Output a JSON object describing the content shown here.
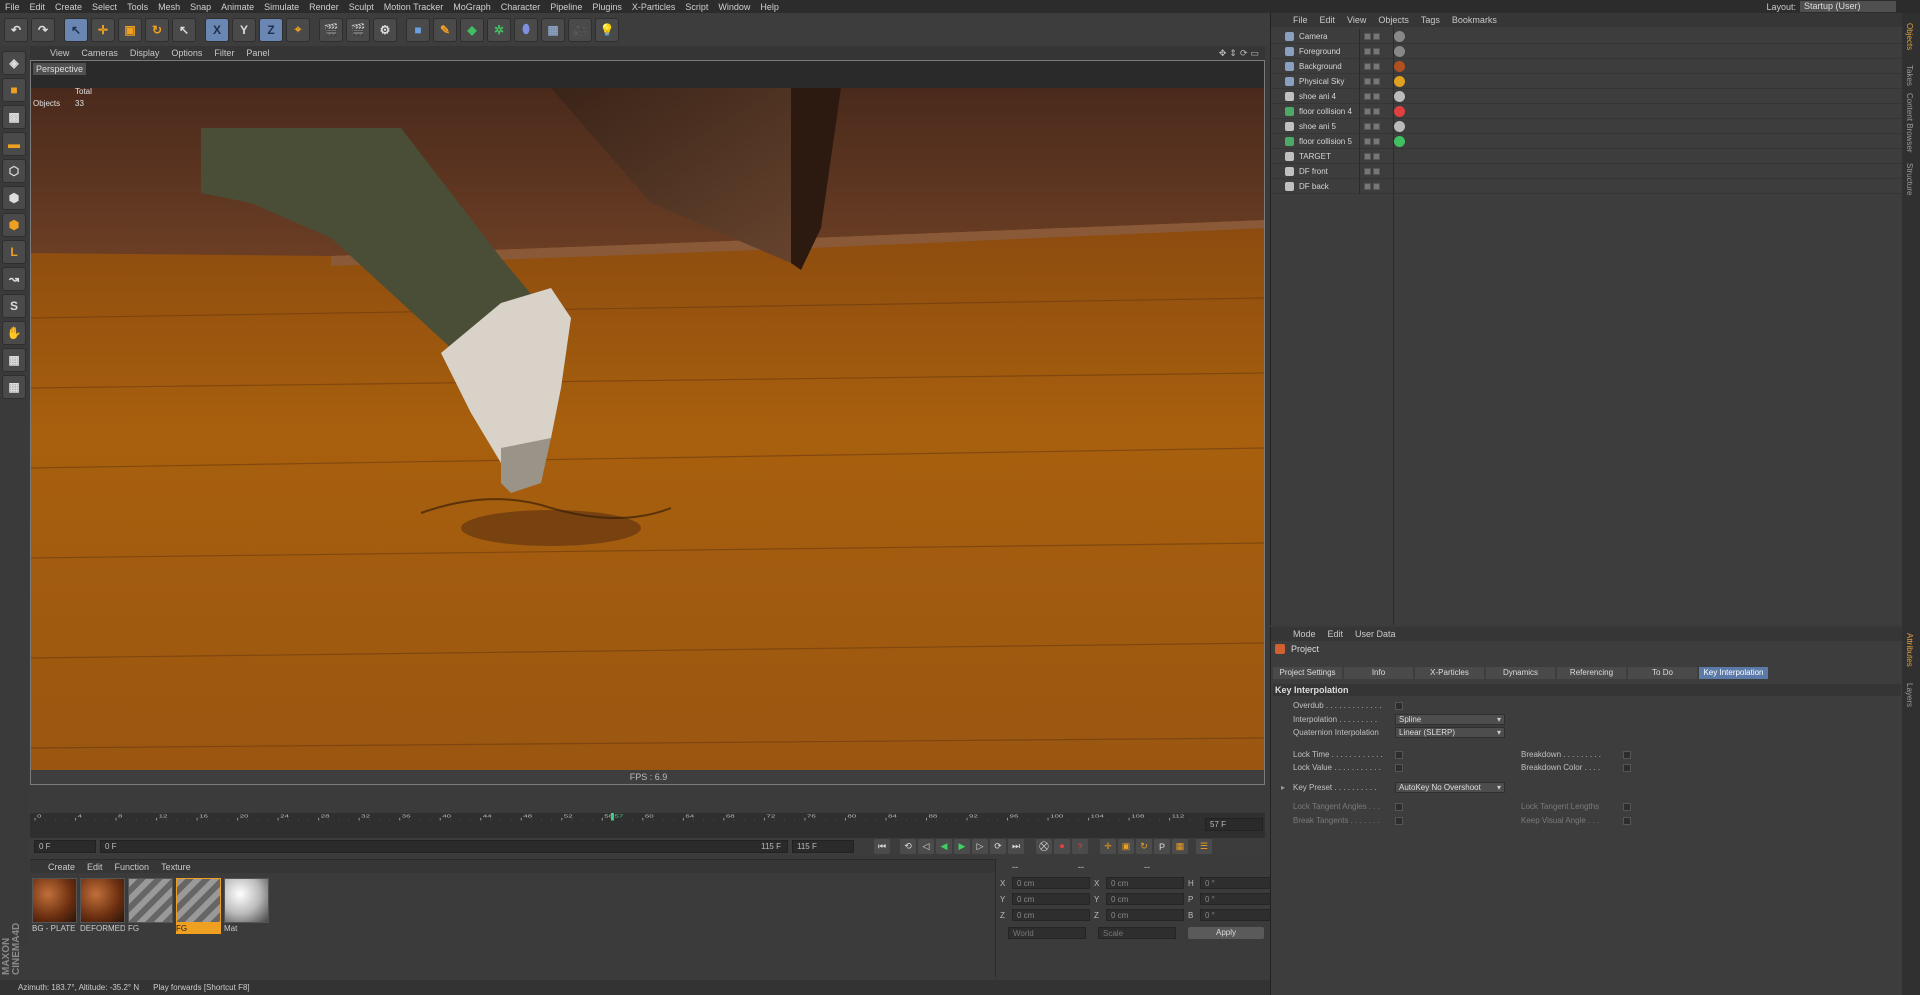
{
  "menubar": {
    "items": [
      "File",
      "Edit",
      "Create",
      "Select",
      "Tools",
      "Mesh",
      "Snap",
      "Animate",
      "Simulate",
      "Render",
      "Sculpt",
      "Motion Tracker",
      "MoGraph",
      "Character",
      "Pipeline",
      "Plugins",
      "X-Particles",
      "Script",
      "Window",
      "Help"
    ],
    "layout_label": "Layout:",
    "layout_value": "Startup (User)"
  },
  "toolbar": {
    "icons": [
      "undo-icon",
      "redo-icon",
      "live-select-icon",
      "move-icon",
      "scale-icon",
      "rotate-icon",
      "recent-tool-icon",
      "x-axis-icon",
      "y-axis-icon",
      "z-axis-icon",
      "coordinate-system-icon",
      "render-view-icon",
      "render-picture-viewer-icon",
      "edit-render-settings-icon",
      "cube-icon",
      "pen-icon",
      "subdivision-icon",
      "cloner-icon",
      "deformer-icon",
      "floor-icon",
      "camera-icon",
      "light-icon"
    ],
    "axis_labels": [
      "X",
      "Y",
      "Z"
    ]
  },
  "viewport": {
    "menu": [
      "View",
      "Cameras",
      "Display",
      "Options",
      "Filter",
      "Panel"
    ],
    "label": "Perspective",
    "stats_total": "Total",
    "stats_objects_label": "Objects",
    "stats_objects_value": "33",
    "fps": "FPS : 6.9"
  },
  "timeline": {
    "ticks": [
      "0",
      "4",
      "8",
      "12",
      "16",
      "20",
      "24",
      "28",
      "32",
      "36",
      "40",
      "44",
      "48",
      "52",
      "56",
      "57",
      "60",
      "64",
      "68",
      "72",
      "76",
      "80",
      "84",
      "88",
      "92",
      "96",
      "100",
      "104",
      "108",
      "112"
    ],
    "current_frame": "57",
    "current_frame_field": "57 F",
    "start_field": "0 F",
    "range_start": "0 F",
    "range_end": "115 F",
    "end_field": "115 F"
  },
  "materials": {
    "menu": [
      "Create",
      "Edit",
      "Function",
      "Texture"
    ],
    "items": [
      {
        "label": "BG - PLATE",
        "color": "#7a3a14"
      },
      {
        "label": "DEFORMED",
        "color": "#7a3a14"
      },
      {
        "label": "FG",
        "color": "#888888"
      },
      {
        "label": "FG",
        "color": "#8a6a4a"
      },
      {
        "label": "Mat",
        "color": "#cccccc"
      }
    ]
  },
  "coords": {
    "headers": [
      "--",
      "--",
      "--"
    ],
    "rows": [
      [
        "X",
        "0 cm",
        "X",
        "0 cm",
        "H",
        "0 °"
      ],
      [
        "Y",
        "0 cm",
        "Y",
        "0 cm",
        "P",
        "0 °"
      ],
      [
        "Z",
        "0 cm",
        "Z",
        "0 cm",
        "B",
        "0 °"
      ]
    ],
    "mode1": "World",
    "mode2": "Scale",
    "apply": "Apply"
  },
  "status": {
    "left": "Azimuth: 183.7°, Altitude: -35.2°  N",
    "right": "Play forwards [Shortcut F8]"
  },
  "objects": {
    "menu": [
      "File",
      "Edit",
      "View",
      "Objects",
      "Tags",
      "Bookmarks"
    ],
    "rows": [
      {
        "name": "Camera",
        "icon_color": "#8aa0c0"
      },
      {
        "name": "Foreground",
        "icon_color": "#8aa0c0"
      },
      {
        "name": "Background",
        "icon_color": "#8aa0c0"
      },
      {
        "name": "Physical Sky",
        "icon_color": "#8aa0c0"
      },
      {
        "name": "shoe ani 4",
        "icon_color": "#c0c0c0"
      },
      {
        "name": "floor collision 4",
        "icon_color": "#4caa66"
      },
      {
        "name": "shoe ani 5",
        "icon_color": "#c0c0c0"
      },
      {
        "name": "floor collision 5",
        "icon_color": "#4caa66"
      },
      {
        "name": "TARGET",
        "icon_color": "#c0c0c0"
      },
      {
        "name": "DF front",
        "icon_color": "#c0c0c0"
      },
      {
        "name": "DF back",
        "icon_color": "#c0c0c0"
      }
    ]
  },
  "attributes": {
    "menu": [
      "Mode",
      "Edit",
      "User Data"
    ],
    "title": "Project",
    "tabs": [
      "Project Settings",
      "Info",
      "X-Particles",
      "Dynamics",
      "Referencing",
      "To Do",
      "Key Interpolation"
    ],
    "section": "Key Interpolation",
    "overdub": "Overdub . . . . . . . . . . . . .",
    "interpolation": "Interpolation . . . . . . . . .",
    "interpolation_value": "Spline",
    "quaternion": "Quaternion Interpolation",
    "quaternion_value": "Linear (SLERP)",
    "lock_time": "Lock Time . . . . . . . . . . . .",
    "lock_value": "Lock Value . . . . . . . . . . .",
    "breakdown": "Breakdown . . . . . . . . .",
    "breakdown_color": "Breakdown Color . . . .",
    "key_preset": "Key Preset . . . . . . . . . .",
    "key_preset_value": "AutoKey No Overshoot",
    "lock_tangent_angles": "Lock Tangent Angles . . .",
    "lock_tangent_lengths": "Lock Tangent Lengths",
    "break_tangents": "Break Tangents . . . . . . .",
    "keep_visual_angle": "Keep Visual Angle . . ."
  },
  "rightstrip": {
    "tabs_top": [
      "Objects",
      "Takes",
      "Content Browser",
      "Structure"
    ],
    "tabs_bottom": [
      "Attributes",
      "Layers"
    ]
  }
}
